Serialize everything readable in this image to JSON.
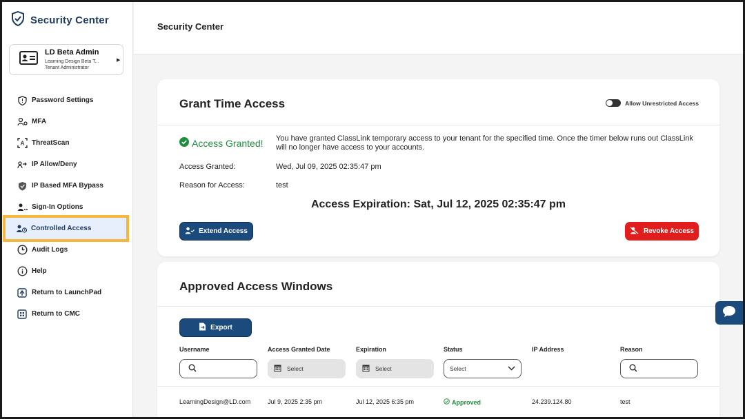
{
  "app": {
    "title": "Security Center"
  },
  "user": {
    "name": "LD Beta Admin",
    "org": "Learning Design Beta T...",
    "role": "Tenant Administrator"
  },
  "nav": [
    {
      "label": "Password Settings",
      "icon": "shield-icon"
    },
    {
      "label": "MFA",
      "icon": "user-key-icon"
    },
    {
      "label": "ThreatScan",
      "icon": "scan-icon"
    },
    {
      "label": "IP Allow/Deny",
      "icon": "network-icon"
    },
    {
      "label": "IP Based MFA Bypass",
      "icon": "shield-bypass-icon"
    },
    {
      "label": "Sign-In Options",
      "icon": "user-options-icon"
    },
    {
      "label": "Controlled Access",
      "icon": "user-clock-icon",
      "active": true
    },
    {
      "label": "Audit Logs",
      "icon": "clock-icon"
    },
    {
      "label": "Help",
      "icon": "info-icon"
    },
    {
      "label": "Return to LaunchPad",
      "icon": "launchpad-icon"
    },
    {
      "label": "Return to CMC",
      "icon": "cmc-icon"
    }
  ],
  "header": {
    "title": "Security Center"
  },
  "grant": {
    "title": "Grant Time Access",
    "toggle_label": "Allow Unrestricted Access",
    "status": "Access Granted!",
    "message": "You have granted ClassLink temporary access to your tenant for the specified time. Once the timer below runs out ClassLink will no longer have access to your accounts.",
    "granted_label": "Access Granted:",
    "granted_value": "Wed, Jul 09, 2025 02:35:47 pm",
    "reason_label": "Reason for Access:",
    "reason_value": "test",
    "expiration": "Access Expiration: Sat, Jul 12, 2025 02:35:47 pm",
    "extend_label": "Extend Access",
    "revoke_label": "Revoke Access"
  },
  "windows": {
    "title": "Approved Access Windows",
    "export_label": "Export",
    "columns": [
      "Username",
      "Access Granted Date",
      "Expiration",
      "Status",
      "IP Address",
      "Reason"
    ],
    "date_placeholder": "Select",
    "status_placeholder": "Select",
    "rows": [
      {
        "username": "LearningDesign@LD.com",
        "granted": "Jul 9, 2025 2:35 pm",
        "expiration": "Jul 12, 2025 6:35 pm",
        "status": "Approved",
        "ip": "24.239.124.80",
        "reason": "test"
      }
    ]
  },
  "colors": {
    "brand": "#1d3a5f",
    "primary": "#1b4b7c",
    "danger": "#e01e1e",
    "success": "#1e8e3e",
    "highlight": "#f6b73c"
  }
}
